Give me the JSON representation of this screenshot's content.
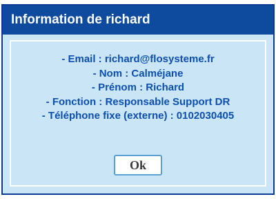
{
  "dialog": {
    "title": "Information de richard",
    "lines": [
      "- Email : richard@flosysteme.fr",
      "- Nom : Calméjane",
      "- Prénom : Richard",
      "- Fonction : Responsable Support DR",
      "- Téléphone fixe (externe) : 0102030405"
    ],
    "ok_label": "Ok"
  },
  "colors": {
    "title_bar": "#0e4a9e",
    "dialog_background": "#c9e5f6",
    "text": "#0d4fb0",
    "ok_border": "#5aa0d2"
  }
}
